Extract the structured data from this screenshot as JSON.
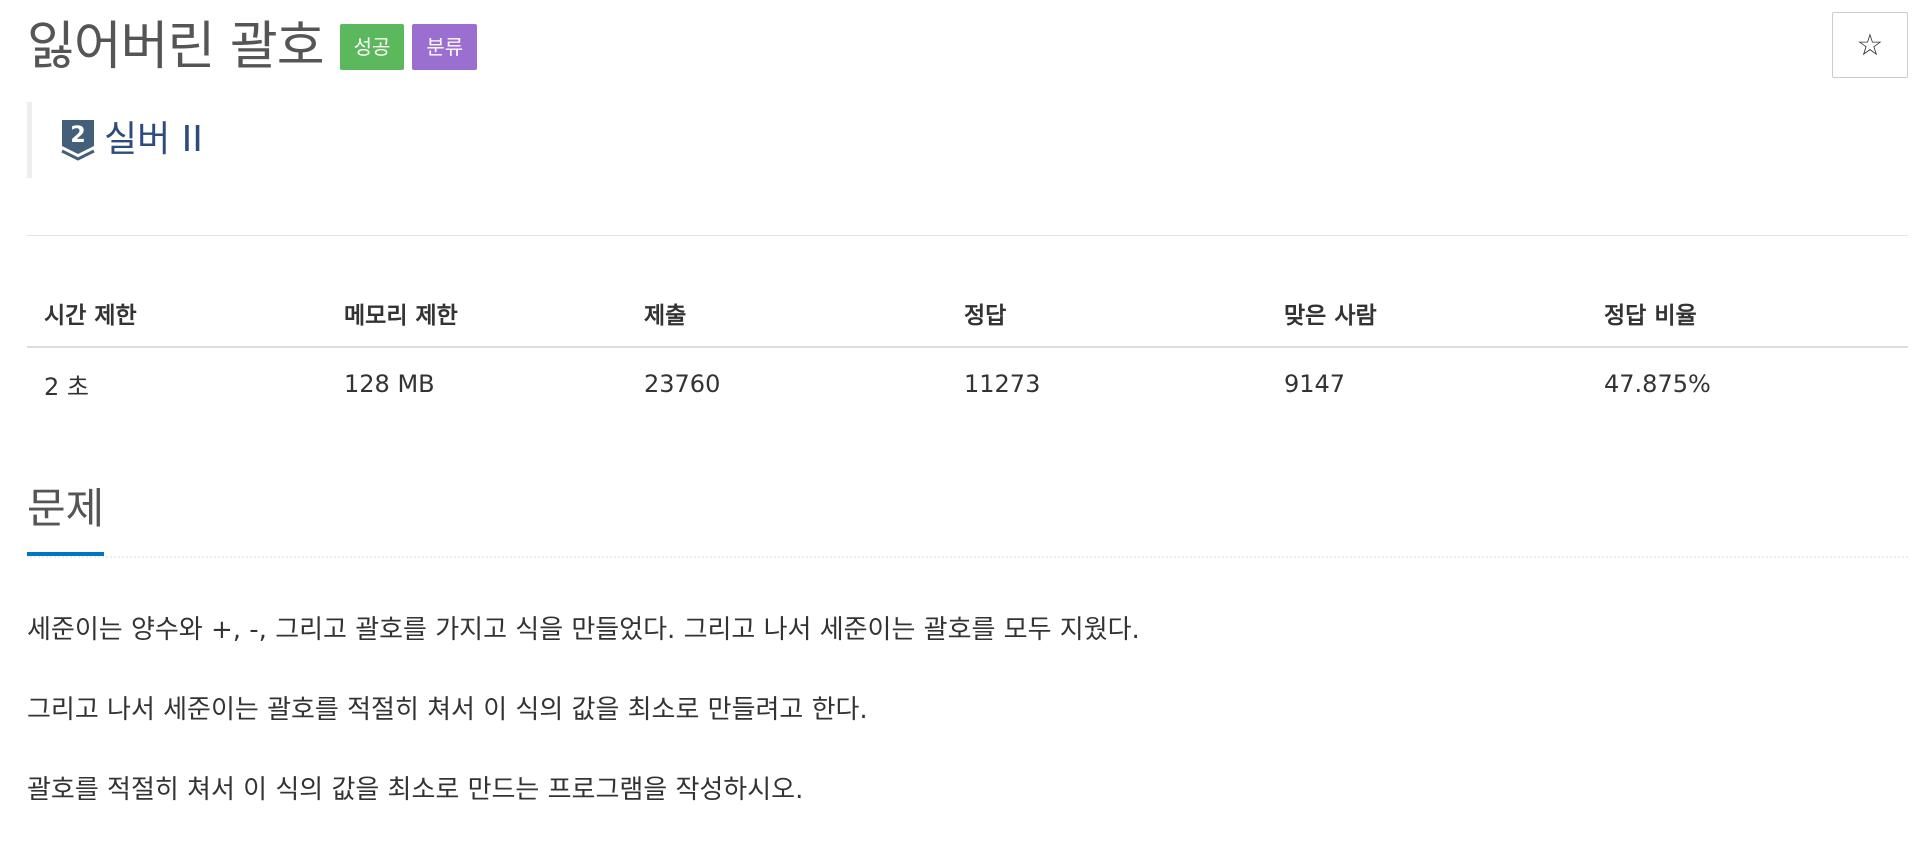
{
  "problem": {
    "title": "잃어버린 괄호",
    "labels": [
      {
        "text": "성공",
        "color": "#5cb85c"
      },
      {
        "text": "분류",
        "color": "#9b6fd0"
      }
    ],
    "star_icon": "star-outline-icon",
    "star_glyph": "☆",
    "tier": {
      "number": "2",
      "text": "실버 II",
      "color": "#2d4b7c",
      "icon": "silver-tier-icon"
    }
  },
  "info_table": {
    "headers": [
      "시간 제한",
      "메모리 제한",
      "제출",
      "정답",
      "맞은 사람",
      "정답 비율"
    ],
    "values": [
      "2 초",
      "128 MB",
      "23760",
      "11273",
      "9147",
      "47.875%"
    ]
  },
  "section": {
    "title": "문제",
    "accent_color": "#0076c0"
  },
  "description": [
    "세준이는 양수와 +, -, 그리고 괄호를 가지고 식을 만들었다. 그리고 나서 세준이는 괄호를 모두 지웠다.",
    "그리고 나서 세준이는 괄호를 적절히 쳐서 이 식의 값을 최소로 만들려고 한다.",
    "괄호를 적절히 쳐서 이 식의 값을 최소로 만드는 프로그램을 작성하시오."
  ]
}
